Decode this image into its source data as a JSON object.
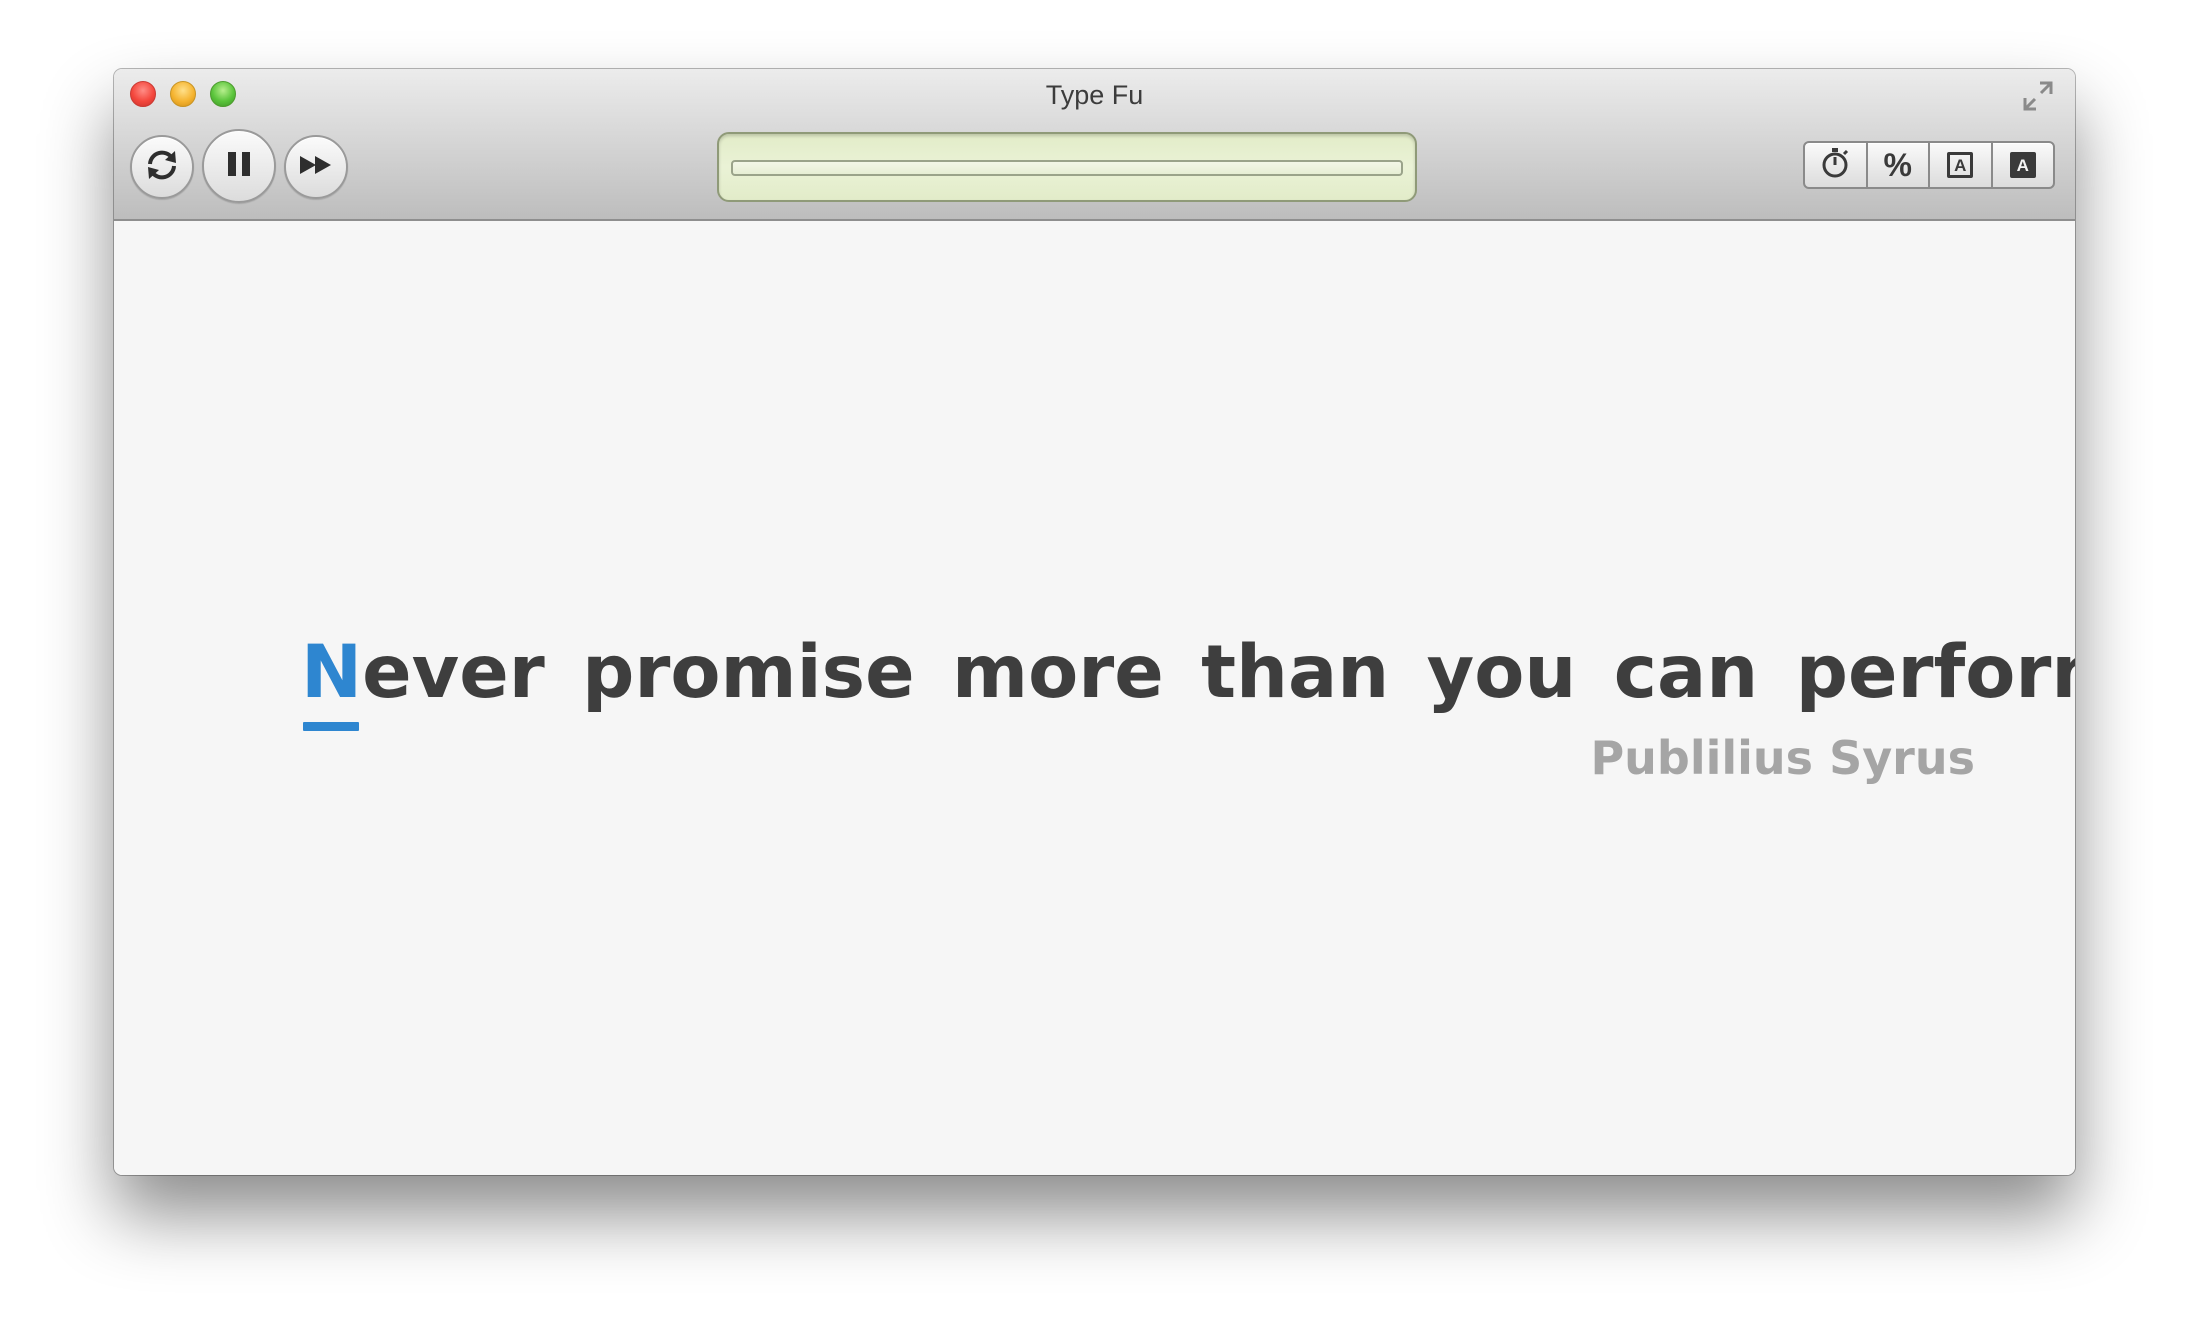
{
  "window": {
    "title": "Type Fu"
  },
  "toolbar": {
    "buttons": [
      {
        "icon": "refresh-icon"
      },
      {
        "icon": "pause-icon"
      },
      {
        "icon": "fast-forward-icon"
      }
    ],
    "progress": 0,
    "view_options": [
      {
        "icon": "stopwatch-icon"
      },
      {
        "label": "%"
      },
      {
        "label": "A",
        "style": "outline"
      },
      {
        "label": "A",
        "style": "filled"
      }
    ]
  },
  "quote": {
    "current_char": "N",
    "remaining": "ever promise more than you can perform.",
    "author": "Publilius Syrus"
  },
  "colors": {
    "accent": "#2e86d0",
    "text": "#3e3e3e",
    "author": "#a5a5a5",
    "progress_bg": "#e6efd0"
  }
}
